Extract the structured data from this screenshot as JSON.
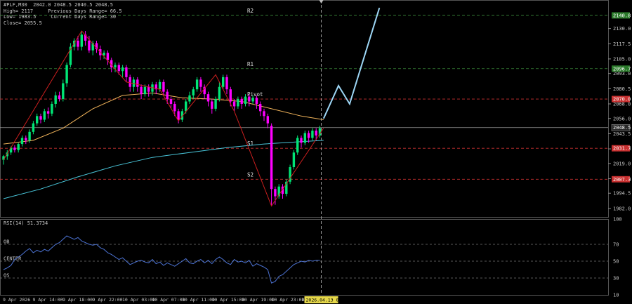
{
  "info": {
    "symbol_line": "#PLF,M30  2042.0 2048.5 2040.5 2048.5",
    "high_line": "High= 2117     Previous Days Range= 66.5",
    "low_line": "Low= 1983.5     Current Days Range= 30",
    "close_line": "Close= 2055.5"
  },
  "colors": {
    "background": "#000000",
    "bull": "#00e676",
    "bear": "#ff00ff",
    "ma_fast": "#f0b35a",
    "ma_slow": "#49c5d9",
    "zigzag": "#cc1f1f",
    "projection": "#9dd6f5",
    "rsi": "#4d74d6",
    "grid_green": "#3a8a3a",
    "grid_red": "#c83030"
  },
  "chart_data": [
    {
      "type": "candlestick",
      "ylim": [
        1975,
        2150
      ],
      "yticks": [
        "2130.0",
        "2117.5",
        "2105.0",
        "2093.0",
        "2080.5",
        "2068.0",
        "2056.0",
        "2043.5",
        "2031.0",
        "2019.0",
        "2006.5",
        "1994.5",
        "1982.0"
      ],
      "x_labels": [
        "9 Apr 2026",
        "9 Apr 14:00",
        "9 Apr 18:00",
        "9 Apr 22:00",
        "10 Apr 03:00",
        "10 Apr 07:00",
        "10 Apr 11:00",
        "10 Apr 15:00",
        "10 Apr 19:00",
        "10 Apr 23:00",
        "13 Ap"
      ],
      "cursor_time_label": "2026.04.13 08:00",
      "levels": [
        {
          "name": "R2",
          "value": 2140.8,
          "label": "2140.8",
          "color": "#3a8a3a",
          "tag": "#2a7a2a"
        },
        {
          "name": "R1",
          "value": 2097.0,
          "label": "2096.7",
          "color": "#3a8a3a",
          "tag": "#2a7a2a"
        },
        {
          "name": "Pivot",
          "value": 2072.0,
          "label": "2070.0",
          "color": "#c83030",
          "tag": "#c83030"
        },
        {
          "name": "S1",
          "value": 2031.5,
          "label": "2031.7",
          "color": "#c83030",
          "tag": "#c83030"
        },
        {
          "name": "S2",
          "value": 2006.0,
          "label": "2007.3",
          "color": "#c83030",
          "tag": "#c83030"
        }
      ],
      "current_price": {
        "value": 2048.5,
        "label": "2048.5"
      },
      "candles": [
        [
          2022,
          2025,
          2018,
          2026
        ],
        [
          2025,
          2028,
          2022,
          2030
        ],
        [
          2028,
          2032,
          2026,
          2033
        ],
        [
          2032,
          2030,
          2028,
          2034
        ],
        [
          2030,
          2035,
          2028,
          2036
        ],
        [
          2035,
          2040,
          2033,
          2042
        ],
        [
          2040,
          2038,
          2035,
          2042
        ],
        [
          2038,
          2045,
          2036,
          2047
        ],
        [
          2045,
          2052,
          2043,
          2054
        ],
        [
          2052,
          2058,
          2050,
          2060
        ],
        [
          2058,
          2055,
          2052,
          2060
        ],
        [
          2055,
          2062,
          2053,
          2064
        ],
        [
          2062,
          2060,
          2056,
          2065
        ],
        [
          2060,
          2068,
          2058,
          2070
        ],
        [
          2068,
          2075,
          2065,
          2078
        ],
        [
          2075,
          2072,
          2070,
          2078
        ],
        [
          2072,
          2085,
          2070,
          2088
        ],
        [
          2085,
          2100,
          2082,
          2102
        ],
        [
          2100,
          2115,
          2098,
          2118
        ],
        [
          2115,
          2120,
          2112,
          2122
        ],
        [
          2120,
          2115,
          2112,
          2124
        ],
        [
          2115,
          2125,
          2112,
          2128
        ],
        [
          2125,
          2120,
          2116,
          2128
        ],
        [
          2120,
          2112,
          2110,
          2124
        ],
        [
          2112,
          2118,
          2108,
          2120
        ],
        [
          2118,
          2113,
          2110,
          2120
        ],
        [
          2113,
          2108,
          2104,
          2116
        ],
        [
          2108,
          2110,
          2105,
          2112
        ],
        [
          2110,
          2104,
          2100,
          2112
        ],
        [
          2104,
          2098,
          2094,
          2106
        ],
        [
          2098,
          2100,
          2094,
          2102
        ],
        [
          2100,
          2095,
          2092,
          2102
        ],
        [
          2095,
          2098,
          2090,
          2100
        ],
        [
          2098,
          2090,
          2086,
          2100
        ],
        [
          2090,
          2082,
          2078,
          2092
        ],
        [
          2082,
          2088,
          2078,
          2090
        ],
        [
          2088,
          2082,
          2078,
          2090
        ],
        [
          2082,
          2076,
          2072,
          2084
        ],
        [
          2076,
          2082,
          2074,
          2084
        ],
        [
          2082,
          2078,
          2074,
          2084
        ],
        [
          2078,
          2084,
          2075,
          2086
        ],
        [
          2084,
          2080,
          2076,
          2086
        ],
        [
          2080,
          2086,
          2078,
          2088
        ],
        [
          2086,
          2078,
          2075,
          2088
        ],
        [
          2078,
          2072,
          2068,
          2080
        ],
        [
          2072,
          2068,
          2064,
          2074
        ],
        [
          2068,
          2062,
          2058,
          2070
        ],
        [
          2062,
          2055,
          2052,
          2064
        ],
        [
          2055,
          2062,
          2053,
          2064
        ],
        [
          2062,
          2070,
          2060,
          2072
        ],
        [
          2070,
          2075,
          2068,
          2078
        ],
        [
          2075,
          2080,
          2072,
          2082
        ],
        [
          2080,
          2088,
          2078,
          2090
        ],
        [
          2088,
          2082,
          2078,
          2090
        ],
        [
          2082,
          2076,
          2072,
          2084
        ],
        [
          2076,
          2070,
          2066,
          2078
        ],
        [
          2070,
          2064,
          2060,
          2072
        ],
        [
          2064,
          2072,
          2062,
          2074
        ],
        [
          2072,
          2082,
          2070,
          2086
        ],
        [
          2082,
          2090,
          2080,
          2092
        ],
        [
          2090,
          2080,
          2076,
          2092
        ],
        [
          2080,
          2070,
          2066,
          2082
        ],
        [
          2070,
          2066,
          2062,
          2072
        ],
        [
          2066,
          2072,
          2064,
          2074
        ],
        [
          2072,
          2068,
          2064,
          2074
        ],
        [
          2068,
          2074,
          2066,
          2076
        ],
        [
          2074,
          2070,
          2066,
          2076
        ],
        [
          2070,
          2073,
          2068,
          2075
        ],
        [
          2073,
          2068,
          2064,
          2075
        ],
        [
          2068,
          2062,
          2058,
          2070
        ],
        [
          2062,
          2058,
          2054,
          2064
        ],
        [
          2058,
          2052,
          2048,
          2060
        ],
        [
          2050,
          1998,
          1984,
          2052
        ],
        [
          1998,
          1992,
          1985,
          2000
        ],
        [
          1992,
          2000,
          1990,
          2002
        ],
        [
          2000,
          1994,
          1990,
          2002
        ],
        [
          1994,
          2004,
          1992,
          2006
        ],
        [
          2004,
          2016,
          2002,
          2018
        ],
        [
          2016,
          2028,
          2014,
          2030
        ],
        [
          2028,
          2040,
          2026,
          2042
        ],
        [
          2040,
          2036,
          2032,
          2042
        ],
        [
          2036,
          2044,
          2034,
          2046
        ],
        [
          2044,
          2040,
          2036,
          2046
        ],
        [
          2040,
          2046,
          2038,
          2048
        ],
        [
          2046,
          2042,
          2038,
          2048
        ],
        [
          2042,
          2048,
          2040,
          2050
        ]
      ],
      "ma_fast": [
        [
          0,
          2035
        ],
        [
          8,
          2038
        ],
        [
          16,
          2048
        ],
        [
          24,
          2064
        ],
        [
          32,
          2075
        ],
        [
          40,
          2077
        ],
        [
          48,
          2073
        ],
        [
          56,
          2072
        ],
        [
          64,
          2070
        ],
        [
          72,
          2064
        ],
        [
          80,
          2058
        ],
        [
          86,
          2055
        ]
      ],
      "ma_slow": [
        [
          0,
          1990
        ],
        [
          10,
          1998
        ],
        [
          20,
          2008
        ],
        [
          30,
          2017
        ],
        [
          40,
          2024
        ],
        [
          50,
          2028
        ],
        [
          60,
          2032
        ],
        [
          70,
          2035
        ],
        [
          80,
          2037
        ],
        [
          86,
          2038
        ]
      ],
      "zigzag": [
        [
          0,
          2022
        ],
        [
          21,
          2128
        ],
        [
          33,
          2086
        ],
        [
          42,
          2080
        ],
        [
          47,
          2054
        ],
        [
          57,
          2092
        ],
        [
          62,
          2062
        ],
        [
          72,
          1984
        ],
        [
          86,
          2048
        ]
      ],
      "projection": [
        [
          86,
          2056
        ],
        [
          90,
          2083
        ],
        [
          93,
          2068
        ],
        [
          101,
          2147
        ]
      ]
    },
    {
      "type": "line",
      "title": "RSI(14) 51.3734",
      "ylim": [
        10,
        100
      ],
      "yticks": [
        100,
        70,
        50,
        30,
        10
      ],
      "levels": [
        {
          "value": 70,
          "label": "OB"
        },
        {
          "value": 50,
          "label": "CENTER"
        },
        {
          "value": 30,
          "label": "OS"
        }
      ],
      "values": [
        40,
        42,
        45,
        52,
        55,
        58,
        62,
        65,
        60,
        63,
        61,
        64,
        62,
        66,
        70,
        72,
        76,
        80,
        78,
        76,
        78,
        74,
        72,
        70,
        69,
        70,
        66,
        64,
        60,
        58,
        55,
        52,
        54,
        50,
        46,
        48,
        50,
        51,
        49,
        48,
        52,
        47,
        49,
        45,
        48,
        46,
        44,
        47,
        50,
        53,
        48,
        47,
        50,
        52,
        48,
        51,
        47,
        52,
        55,
        52,
        48,
        46,
        52,
        49,
        50,
        48,
        51,
        44,
        47,
        45,
        43,
        40,
        24,
        26,
        32,
        34,
        38,
        42,
        46,
        48,
        50,
        49,
        51,
        50,
        51,
        51
      ]
    }
  ]
}
